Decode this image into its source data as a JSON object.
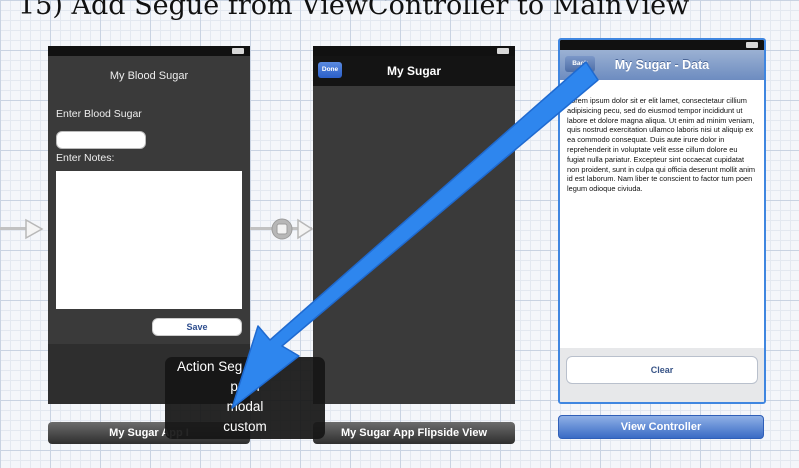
{
  "heading": "15) Add Segue from ViewController to MainView",
  "screen1": {
    "title": "My Blood Sugar",
    "enter_blood_sugar_label": "Enter Blood Sugar",
    "enter_notes_label": "Enter Notes:",
    "save_button": "Save",
    "scene_label": "My Sugar App I"
  },
  "screen2": {
    "done_button": "Done",
    "title": "My Sugar",
    "scene_label": "My Sugar App Flipside View"
  },
  "screen3": {
    "back_button": "Back",
    "title": "My Sugar - Data",
    "body_text": "Lorem ipsum dolor sit er elit lamet, consectetaur cillium adipisicing pecu, sed do eiusmod tempor incididunt ut labore et dolore magna aliqua. Ut enim ad minim veniam, quis nostrud exercitation ullamco laboris nisi ut aliquip ex ea commodo consequat. Duis aute irure dolor in reprehenderit in voluptate velit esse cillum dolore eu fugiat nulla pariatur. Excepteur sint occaecat cupidatat non proident, sunt in culpa qui officia deserunt mollit anim id est laborum. Nam liber te conscient to factor tum poen legum odioque civiuda.",
    "clear_button": "Clear",
    "scene_label": "View Controller"
  },
  "action_segue_menu": {
    "header": "Action Seg",
    "options": [
      "push",
      "modal",
      "custom"
    ]
  },
  "colors": {
    "arrow": "#2e86ee",
    "selection_border": "#3f86e0"
  }
}
